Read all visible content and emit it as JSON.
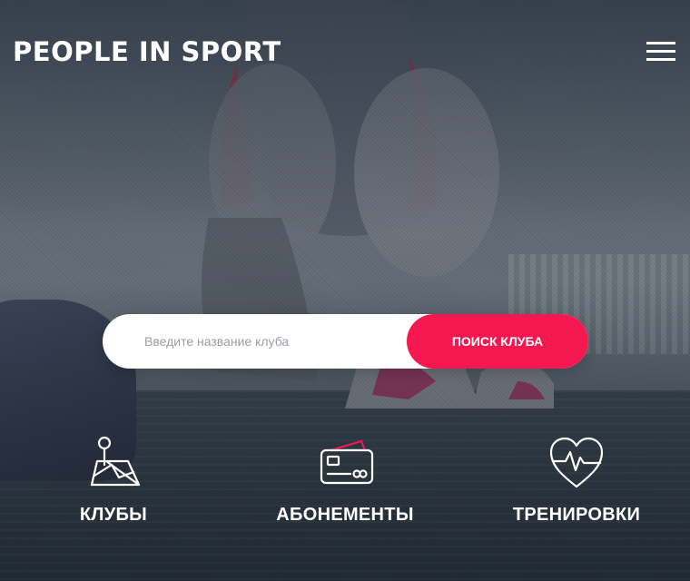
{
  "header": {
    "logo_text": "PEOPLE IN SPORT"
  },
  "search": {
    "placeholder": "Введите название клуба",
    "value": "",
    "button_label": "ПОИСК КЛУБА"
  },
  "features": [
    {
      "label": "КЛУБЫ",
      "icon": "map-pin-icon"
    },
    {
      "label": "АБОНЕМЕНТЫ",
      "icon": "membership-card-icon"
    },
    {
      "label": "ТРЕНИРОВКИ",
      "icon": "heart-pulse-icon"
    }
  ],
  "colors": {
    "accent": "#f5174f",
    "text_light": "#ffffff"
  }
}
